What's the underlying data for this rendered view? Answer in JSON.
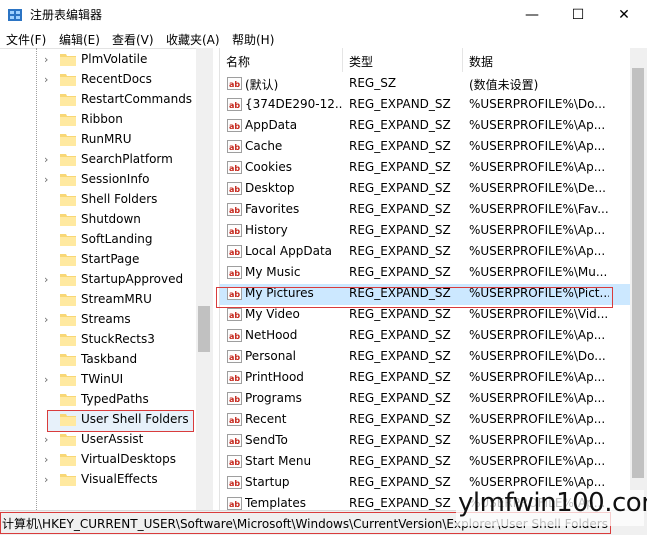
{
  "window": {
    "title": "注册表编辑器"
  },
  "titlebar": {
    "minimize": "—",
    "maximize": "☐",
    "close": "✕"
  },
  "menu": [
    "文件(F)",
    "编辑(E)",
    "查看(V)",
    "收藏夹(A)",
    "帮助(H)"
  ],
  "tree": {
    "items": [
      {
        "label": "PlmVolatile",
        "expandable": true
      },
      {
        "label": "RecentDocs",
        "expandable": true
      },
      {
        "label": "RestartCommands",
        "expandable": false
      },
      {
        "label": "Ribbon",
        "expandable": false
      },
      {
        "label": "RunMRU",
        "expandable": false
      },
      {
        "label": "SearchPlatform",
        "expandable": true
      },
      {
        "label": "SessionInfo",
        "expandable": true
      },
      {
        "label": "Shell Folders",
        "expandable": false
      },
      {
        "label": "Shutdown",
        "expandable": false
      },
      {
        "label": "SoftLanding",
        "expandable": false
      },
      {
        "label": "StartPage",
        "expandable": false
      },
      {
        "label": "StartupApproved",
        "expandable": true
      },
      {
        "label": "StreamMRU",
        "expandable": false
      },
      {
        "label": "Streams",
        "expandable": true
      },
      {
        "label": "StuckRects3",
        "expandable": false
      },
      {
        "label": "Taskband",
        "expandable": false
      },
      {
        "label": "TWinUI",
        "expandable": true
      },
      {
        "label": "TypedPaths",
        "expandable": false
      },
      {
        "label": "User Shell Folders",
        "expandable": false,
        "selected": true
      },
      {
        "label": "UserAssist",
        "expandable": true
      },
      {
        "label": "VirtualDesktops",
        "expandable": true
      },
      {
        "label": "VisualEffects",
        "expandable": true
      }
    ]
  },
  "list": {
    "headers": [
      "名称",
      "类型",
      "数据"
    ],
    "rows": [
      {
        "name": "(默认)",
        "type": "REG_SZ",
        "data": "(数值未设置)"
      },
      {
        "name": "{374DE290-12...",
        "type": "REG_EXPAND_SZ",
        "data": "%USERPROFILE%\\Do..."
      },
      {
        "name": "AppData",
        "type": "REG_EXPAND_SZ",
        "data": "%USERPROFILE%\\Ap..."
      },
      {
        "name": "Cache",
        "type": "REG_EXPAND_SZ",
        "data": "%USERPROFILE%\\Ap..."
      },
      {
        "name": "Cookies",
        "type": "REG_EXPAND_SZ",
        "data": "%USERPROFILE%\\Ap..."
      },
      {
        "name": "Desktop",
        "type": "REG_EXPAND_SZ",
        "data": "%USERPROFILE%\\De..."
      },
      {
        "name": "Favorites",
        "type": "REG_EXPAND_SZ",
        "data": "%USERPROFILE%\\Fav..."
      },
      {
        "name": "History",
        "type": "REG_EXPAND_SZ",
        "data": "%USERPROFILE%\\Ap..."
      },
      {
        "name": "Local AppData",
        "type": "REG_EXPAND_SZ",
        "data": "%USERPROFILE%\\Ap..."
      },
      {
        "name": "My Music",
        "type": "REG_EXPAND_SZ",
        "data": "%USERPROFILE%\\Mu..."
      },
      {
        "name": "My Pictures",
        "type": "REG_EXPAND_SZ",
        "data": "%USERPROFILE%\\Pict...",
        "highlight": true
      },
      {
        "name": "My Video",
        "type": "REG_EXPAND_SZ",
        "data": "%USERPROFILE%\\Vid..."
      },
      {
        "name": "NetHood",
        "type": "REG_EXPAND_SZ",
        "data": "%USERPROFILE%\\Ap..."
      },
      {
        "name": "Personal",
        "type": "REG_EXPAND_SZ",
        "data": "%USERPROFILE%\\Do..."
      },
      {
        "name": "PrintHood",
        "type": "REG_EXPAND_SZ",
        "data": "%USERPROFILE%\\Ap..."
      },
      {
        "name": "Programs",
        "type": "REG_EXPAND_SZ",
        "data": "%USERPROFILE%\\Ap..."
      },
      {
        "name": "Recent",
        "type": "REG_EXPAND_SZ",
        "data": "%USERPROFILE%\\Ap..."
      },
      {
        "name": "SendTo",
        "type": "REG_EXPAND_SZ",
        "data": "%USERPROFILE%\\Ap..."
      },
      {
        "name": "Start Menu",
        "type": "REG_EXPAND_SZ",
        "data": "%USERPROFILE%\\Ap..."
      },
      {
        "name": "Startup",
        "type": "REG_EXPAND_SZ",
        "data": "%USERPROFILE%\\Ap..."
      },
      {
        "name": "Templates",
        "type": "REG_EXPAND_SZ",
        "data": "%USERPROFILE%\\Ap..."
      }
    ]
  },
  "status": {
    "path": "计算机\\HKEY_CURRENT_USER\\Software\\Microsoft\\Windows\\CurrentVersion\\Explorer\\User Shell Folders"
  },
  "watermark": {
    "text": "ylmfwin100.com"
  },
  "colors": {
    "selection": "#cce8ff",
    "highlight_border": "#d93c3c",
    "folder": "#f8d775"
  }
}
